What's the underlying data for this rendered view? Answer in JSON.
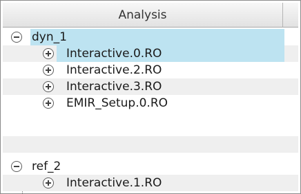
{
  "header": {
    "column_title": "Analysis"
  },
  "groups": [
    {
      "name": "dyn_1",
      "expanded": true,
      "toggle": "minus",
      "children": [
        {
          "name": "Interactive.0.RO",
          "toggle": "plus",
          "selected": true
        },
        {
          "name": "Interactive.2.RO",
          "toggle": "plus",
          "selected": false
        },
        {
          "name": "Interactive.3.RO",
          "toggle": "plus",
          "selected": false
        },
        {
          "name": "EMIR_Setup.0.RO",
          "toggle": "plus",
          "selected": false
        }
      ]
    },
    {
      "name": "ref_2",
      "expanded": true,
      "toggle": "minus",
      "children": [
        {
          "name": "Interactive.1.RO",
          "toggle": "plus",
          "selected": false
        }
      ]
    }
  ],
  "colors": {
    "selection": "#bde3f1",
    "alt_row": "#efefef",
    "header_bg": "#e8e8e8"
  }
}
